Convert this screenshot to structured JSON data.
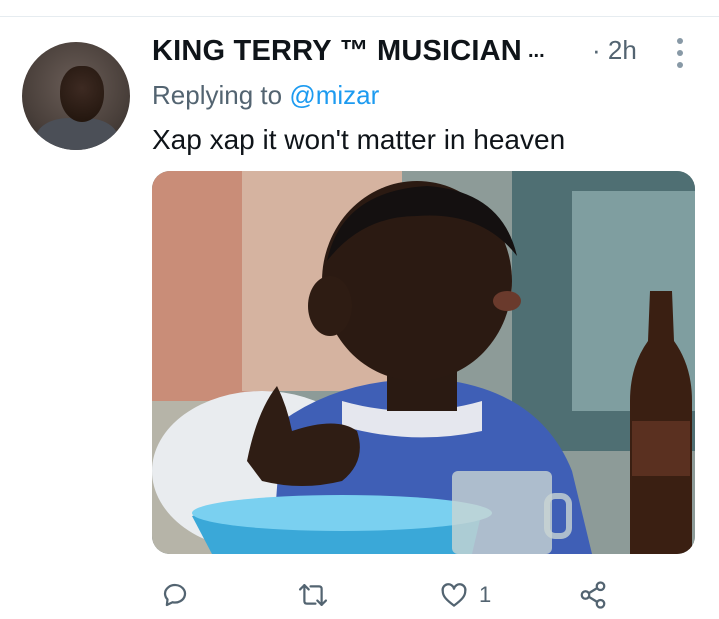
{
  "tweet": {
    "author_name": "KING TERRY ™ MUSICIAN",
    "name_truncation": "...",
    "time_separator": "·",
    "time": "2h",
    "replying_prefix": "Replying to",
    "replying_handle": "@mizar",
    "text": "Xap xap it won't matter in heaven",
    "media_description": "Image: boy with blue shirt making a gesture, bowl and bottle in foreground"
  },
  "actions": {
    "reply_count": "",
    "retweet_count": "",
    "like_count": "1",
    "share_count": ""
  },
  "icons": {
    "reply": "reply-icon",
    "retweet": "retweet-icon",
    "like": "heart-icon",
    "share": "share-icon",
    "more": "more-vertical-icon"
  },
  "colors": {
    "text_primary": "#0f1419",
    "text_secondary": "#536471",
    "link_blue": "#1d9bf0",
    "divider": "#e6ecf0"
  }
}
